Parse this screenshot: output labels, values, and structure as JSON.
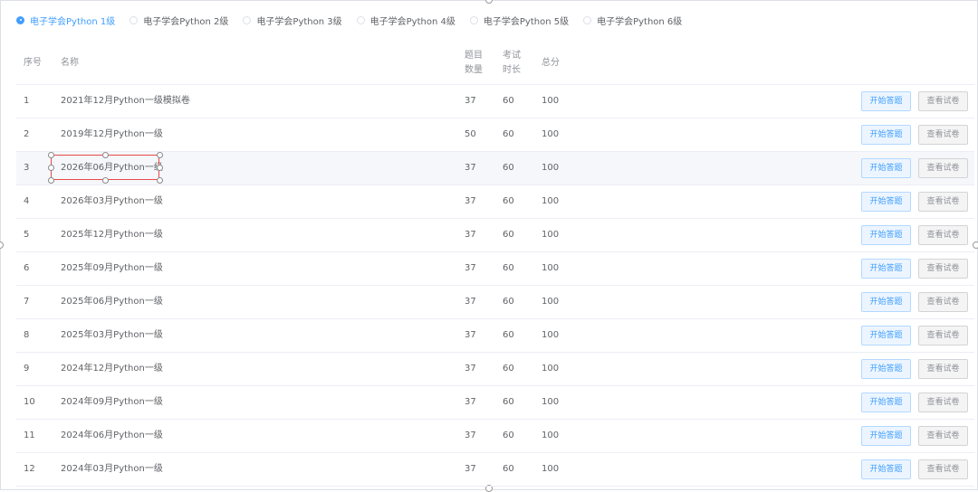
{
  "radio_options": [
    {
      "label": "电子学会Python 1级",
      "checked": true
    },
    {
      "label": "电子学会Python 2级",
      "checked": false
    },
    {
      "label": "电子学会Python 3级",
      "checked": false
    },
    {
      "label": "电子学会Python 4级",
      "checked": false
    },
    {
      "label": "电子学会Python 5级",
      "checked": false
    },
    {
      "label": "电子学会Python 6级",
      "checked": false
    }
  ],
  "table": {
    "headers": {
      "index": "序号",
      "name": "名称",
      "count_line1": "题目",
      "count_line2": "数量",
      "time_line1": "考试",
      "time_line2": "时长",
      "score": "总分"
    },
    "start_label": "开始答题",
    "view_label": "查看试卷",
    "rows": [
      {
        "index": "1",
        "name": "2021年12月Python一级模拟卷",
        "count": "37",
        "time": "60",
        "score": "100"
      },
      {
        "index": "2",
        "name": "2019年12月Python一级",
        "count": "50",
        "time": "60",
        "score": "100"
      },
      {
        "index": "3",
        "name": "2026年06月Python一级",
        "count": "37",
        "time": "60",
        "score": "100"
      },
      {
        "index": "4",
        "name": "2026年03月Python一级",
        "count": "37",
        "time": "60",
        "score": "100"
      },
      {
        "index": "5",
        "name": "2025年12月Python一级",
        "count": "37",
        "time": "60",
        "score": "100"
      },
      {
        "index": "6",
        "name": "2025年09月Python一级",
        "count": "37",
        "time": "60",
        "score": "100"
      },
      {
        "index": "7",
        "name": "2025年06月Python一级",
        "count": "37",
        "time": "60",
        "score": "100"
      },
      {
        "index": "8",
        "name": "2025年03月Python一级",
        "count": "37",
        "time": "60",
        "score": "100"
      },
      {
        "index": "9",
        "name": "2024年12月Python一级",
        "count": "37",
        "time": "60",
        "score": "100"
      },
      {
        "index": "10",
        "name": "2024年09月Python一级",
        "count": "37",
        "time": "60",
        "score": "100"
      },
      {
        "index": "11",
        "name": "2024年06月Python一级",
        "count": "37",
        "time": "60",
        "score": "100"
      },
      {
        "index": "12",
        "name": "2024年03月Python一级",
        "count": "37",
        "time": "60",
        "score": "100"
      }
    ]
  },
  "colors": {
    "accent": "#409eff",
    "selection_border": "#e84a4a"
  }
}
